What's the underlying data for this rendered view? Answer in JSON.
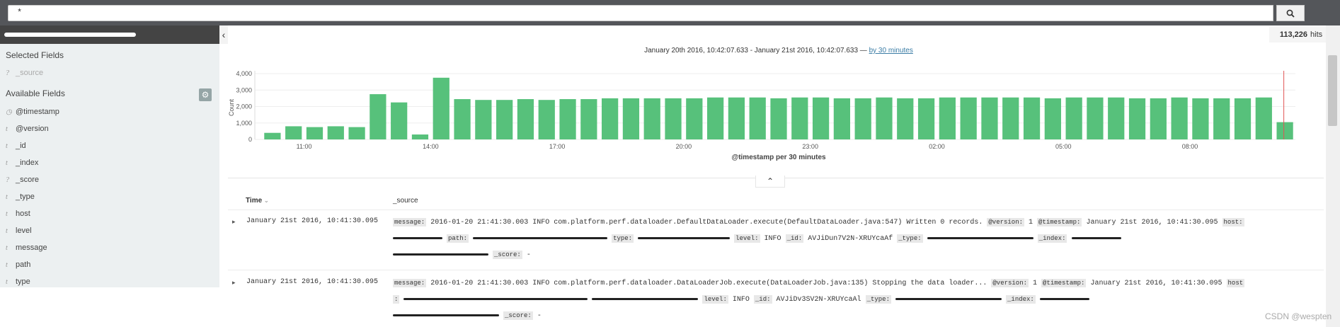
{
  "search": {
    "query": "*"
  },
  "sidebar": {
    "selected_title": "Selected Fields",
    "selected_fields": [
      {
        "type": "?",
        "name": "_source"
      }
    ],
    "available_title": "Available Fields",
    "fields": [
      {
        "type": "clock",
        "name": "@timestamp"
      },
      {
        "type": "t",
        "name": "@version"
      },
      {
        "type": "t",
        "name": "_id"
      },
      {
        "type": "t",
        "name": "_index"
      },
      {
        "type": "?",
        "name": "_score"
      },
      {
        "type": "t",
        "name": "_type"
      },
      {
        "type": "t",
        "name": "host"
      },
      {
        "type": "t",
        "name": "level"
      },
      {
        "type": "t",
        "name": "message"
      },
      {
        "type": "t",
        "name": "path"
      },
      {
        "type": "t",
        "name": "type"
      }
    ]
  },
  "hits": {
    "count": "113,226",
    "label": "hits"
  },
  "range": {
    "text": "January 20th 2016, 10:42:07.633 - January 21st 2016, 10:42:07.633 —",
    "interval_link": "by 30 minutes"
  },
  "chart_data": {
    "type": "bar",
    "title": "",
    "xlabel": "@timestamp per 30 minutes",
    "ylabel": "Count",
    "ylim": [
      0,
      4000
    ],
    "yticks": [
      "0",
      "1,000",
      "2,000",
      "3,000",
      "4,000"
    ],
    "xticks": [
      "11:00",
      "14:00",
      "17:00",
      "20:00",
      "23:00",
      "02:00",
      "05:00",
      "08:00"
    ],
    "values": [
      400,
      800,
      750,
      800,
      750,
      2750,
      2250,
      300,
      3750,
      2450,
      2400,
      2400,
      2450,
      2400,
      2450,
      2450,
      2500,
      2500,
      2500,
      2500,
      2500,
      2550,
      2550,
      2550,
      2500,
      2550,
      2550,
      2500,
      2500,
      2550,
      2500,
      2500,
      2550,
      2550,
      2550,
      2550,
      2550,
      2500,
      2550,
      2550,
      2550,
      2500,
      2500,
      2550,
      2500,
      2500,
      2500,
      2550,
      1050
    ],
    "color": "#57c17b",
    "marker_color": "#e05555",
    "grid": true
  },
  "table": {
    "time_header": "Time",
    "source_header": "_source",
    "rows": [
      {
        "time": "January 21st 2016, 10:41:30.095",
        "line1_msg": "2016-01-20 21:41:30.003 INFO com.platform.perf.dataloader.DefaultDataLoader.execute(DefaultDataLoader.java:547) Written 0 records.",
        "version": "1",
        "timestamp": "January 21st 2016, 10:41:30.095",
        "level": "INFO",
        "id": "AVJiDun7V2N-XRUYcaAf",
        "score": "-"
      },
      {
        "time": "January 21st 2016, 10:41:30.095",
        "line1_msg": "2016-01-20 21:41:30.003 INFO com.platform.perf.dataloader.DataLoaderJob.execute(DataLoaderJob.java:135) Stopping the data loader...",
        "version": "1",
        "timestamp": "January 21st 2016, 10:41:30.095",
        "level": "INFO",
        "id": "AVJiDv3SV2N-XRUYcaAl",
        "score": "-"
      }
    ],
    "labels": {
      "message": "message:",
      "version": "@version:",
      "timestamp": "@timestamp:",
      "host": "host:",
      "host_split": "host",
      "path": "path:",
      "type": "type:",
      "level": "level:",
      "id": "_id:",
      "utype": "_type:",
      "index": "_index:",
      "score": "_score:",
      "colon": ":"
    }
  },
  "watermark": "CSDN @wespten"
}
